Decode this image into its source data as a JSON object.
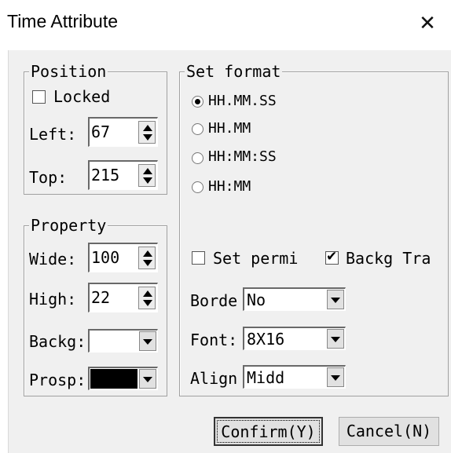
{
  "window": {
    "title": "Time Attribute",
    "close_glyph": "✕"
  },
  "position": {
    "legend": "Position",
    "locked_label": "Locked",
    "locked_checked": false,
    "left_label": "Left:",
    "left_value": "67",
    "top_label": "Top:",
    "top_value": "215"
  },
  "property": {
    "legend": "Property",
    "wide_label": "Wide:",
    "wide_value": "100",
    "high_label": "High:",
    "high_value": "22",
    "backg_label": "Backg:",
    "backg_color": "#ffffff",
    "prosp_label": "Prosp:",
    "prosp_color": "#000000"
  },
  "format": {
    "legend": "Set format",
    "options": [
      "HH.MM.SS",
      "HH.MM",
      "HH:MM:SS",
      "HH:MM"
    ],
    "selected_index": 0,
    "set_permi_label": "Set permi",
    "set_permi_checked": false,
    "backg_tra_label": "Backg Tra",
    "backg_tra_checked": true,
    "border_label": "Borde",
    "border_value": "No",
    "font_label": "Font:",
    "font_value": "8X16",
    "align_label": "Align",
    "align_value": "Midd"
  },
  "buttons": {
    "confirm": "Confirm(Y)",
    "cancel": "Cancel(N)"
  },
  "icons": {
    "close": "close-icon",
    "check": "checkmark-icon"
  }
}
